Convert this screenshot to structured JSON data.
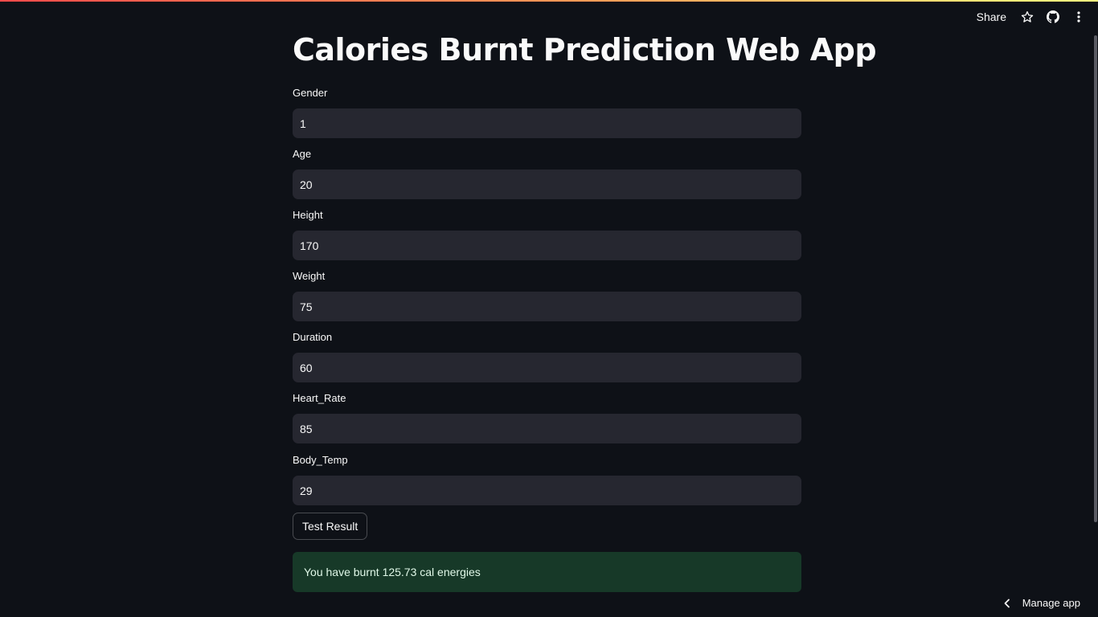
{
  "header": {
    "share_label": "Share",
    "icons": [
      "star-icon",
      "github-icon",
      "more-vertical-icon"
    ]
  },
  "colors": {
    "background": "#0e1117",
    "input_bg": "#262730",
    "success_bg": "#173928",
    "accent": "#ff4b4b"
  },
  "title": "Calories Burnt Prediction Web App",
  "fields": [
    {
      "label": "Gender",
      "value": "1"
    },
    {
      "label": "Age",
      "value": "20"
    },
    {
      "label": "Height",
      "value": "170"
    },
    {
      "label": "Weight",
      "value": "75"
    },
    {
      "label": "Duration",
      "value": "60"
    },
    {
      "label": "Heart_Rate",
      "value": "85"
    },
    {
      "label": "Body_Temp",
      "value": "29"
    }
  ],
  "button_label": "Test Result",
  "result_text": "You have burnt 125.73 cal energies",
  "footer": {
    "manage_label": "Manage app"
  }
}
